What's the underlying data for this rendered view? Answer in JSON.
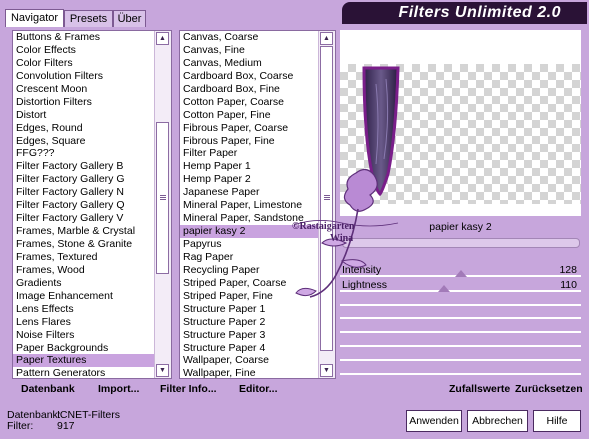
{
  "app_title": "Filters Unlimited 2.0",
  "tabs": [
    {
      "label": "Navigator",
      "active": true
    },
    {
      "label": "Presets",
      "active": false
    },
    {
      "label": "Über",
      "active": false
    }
  ],
  "categories": [
    "Buttons & Frames",
    "Color Effects",
    "Color Filters",
    "Convolution Filters",
    "Crescent Moon",
    "Distortion Filters",
    "Distort",
    "Edges, Round",
    "Edges, Square",
    "FFG???",
    "Filter Factory Gallery B",
    "Filter Factory Gallery G",
    "Filter Factory Gallery N",
    "Filter Factory Gallery Q",
    "Filter Factory Gallery V",
    "Frames, Marble & Crystal",
    "Frames, Stone & Granite",
    "Frames, Textured",
    "Frames, Wood",
    "Gradients",
    "Image Enhancement",
    "Lens Effects",
    "Lens Flares",
    "Noise Filters",
    "Paper Backgrounds",
    "Paper Textures",
    "Pattern Generators"
  ],
  "selected_category": "Paper Textures",
  "filters": [
    "Canvas, Coarse",
    "Canvas, Fine",
    "Canvas, Medium",
    "Cardboard Box, Coarse",
    "Cardboard Box, Fine",
    "Cotton Paper, Coarse",
    "Cotton Paper, Fine",
    "Fibrous Paper, Coarse",
    "Fibrous Paper, Fine",
    "Filter Paper",
    "Hemp Paper 1",
    "Hemp Paper 2",
    "Japanese Paper",
    "Mineral Paper, Limestone",
    "Mineral Paper, Sandstone",
    "papier kasy 2",
    "Papyrus",
    "Rag Paper",
    "Recycling Paper",
    "Striped Paper, Coarse",
    "Striped Paper, Fine",
    "Structure Paper 1",
    "Structure Paper 2",
    "Structure Paper 3",
    "Structure Paper 4",
    "Wallpaper, Coarse",
    "Wallpaper, Fine"
  ],
  "selected_filter": "papier kasy 2",
  "preview": {
    "filter_name": "papier kasy 2",
    "sliders": [
      {
        "label": "Intensity",
        "value": 128,
        "max": 255
      },
      {
        "label": "Lightness",
        "value": 110,
        "max": 255
      }
    ]
  },
  "watermark_lines": [
    "©Rastaigarten",
    "Wina"
  ],
  "actions": {
    "datenbank": "Datenbank",
    "import": "Import...",
    "filter_info": "Filter Info...",
    "editor": "Editor...",
    "zufallswerte": "Zufallswerte",
    "zuruecksetzen": "Zurücksetzen"
  },
  "status": {
    "database_label": "Datenbank:",
    "database_value": "ICNET-Filters",
    "filter_label": "Filter:",
    "filter_value": "917"
  },
  "buttons": {
    "apply": "Anwenden",
    "cancel": "Abbrechen",
    "help": "Hilfe"
  },
  "colors": {
    "accent": "#c7a6dc",
    "selection": "#c9a3df",
    "title_bg": "#2a1236",
    "preview_shape": "#3b2a5a",
    "preview_border": "#7a1e8a"
  }
}
